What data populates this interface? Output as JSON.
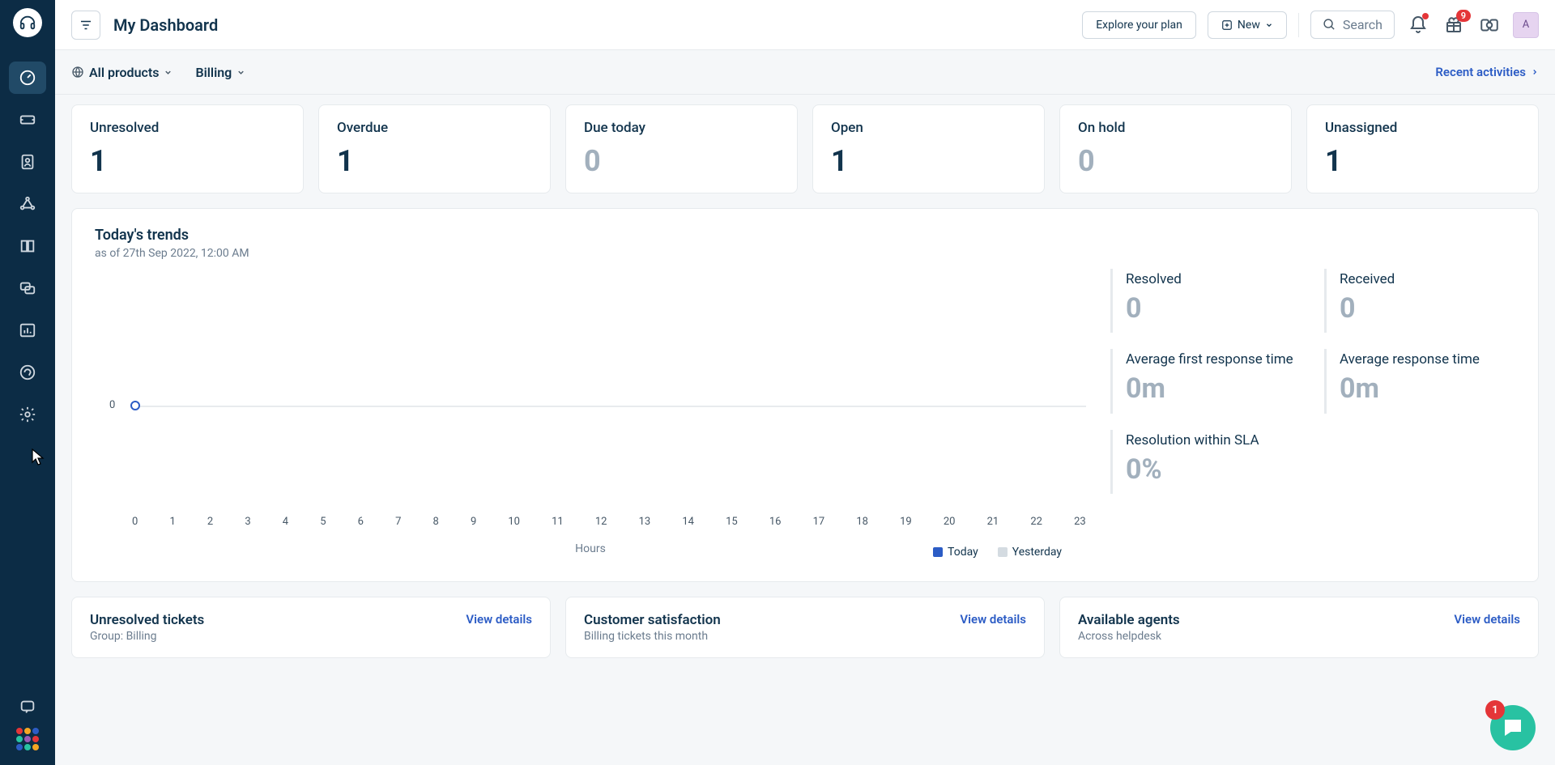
{
  "header": {
    "title": "My Dashboard",
    "explore": "Explore your plan",
    "new": "New",
    "search_placeholder": "Search",
    "gift_badge": "9",
    "avatar": "A"
  },
  "subheader": {
    "products": "All products",
    "group": "Billing",
    "recent": "Recent activities"
  },
  "stats": [
    {
      "label": "Unresolved",
      "value": "1",
      "zero": false
    },
    {
      "label": "Overdue",
      "value": "1",
      "zero": false
    },
    {
      "label": "Due today",
      "value": "0",
      "zero": true
    },
    {
      "label": "Open",
      "value": "1",
      "zero": false
    },
    {
      "label": "On hold",
      "value": "0",
      "zero": true
    },
    {
      "label": "Unassigned",
      "value": "1",
      "zero": false
    }
  ],
  "trends": {
    "title": "Today's trends",
    "subtitle": "as of 27th Sep 2022, 12:00 AM",
    "xlabel": "Hours",
    "legend_today": "Today",
    "legend_yesterday": "Yesterday",
    "y0": "0",
    "side": [
      {
        "label": "Resolved",
        "value": "0"
      },
      {
        "label": "Received",
        "value": "0"
      },
      {
        "label": "Average first response time",
        "value": "0m"
      },
      {
        "label": "Average response time",
        "value": "0m"
      },
      {
        "label": "Resolution within SLA",
        "value": "0%"
      }
    ]
  },
  "bottom": [
    {
      "title": "Unresolved tickets",
      "sub": "Group: Billing",
      "vd": "View details"
    },
    {
      "title": "Customer satisfaction",
      "sub": "Billing tickets this month",
      "vd": "View details"
    },
    {
      "title": "Available agents",
      "sub": "Across helpdesk",
      "vd": "View details"
    }
  ],
  "fab_badge": "1",
  "chart_data": {
    "type": "line",
    "x": [
      0,
      1,
      2,
      3,
      4,
      5,
      6,
      7,
      8,
      9,
      10,
      11,
      12,
      13,
      14,
      15,
      16,
      17,
      18,
      19,
      20,
      21,
      22,
      23
    ],
    "series": [
      {
        "name": "Today",
        "values": [
          0
        ]
      },
      {
        "name": "Yesterday",
        "values": []
      }
    ],
    "xlabel": "Hours",
    "ylabel": "",
    "ylim": [
      0,
      0
    ],
    "title": "Today's trends"
  },
  "xticks": [
    "0",
    "1",
    "2",
    "3",
    "4",
    "5",
    "6",
    "7",
    "8",
    "9",
    "10",
    "11",
    "12",
    "13",
    "14",
    "15",
    "16",
    "17",
    "18",
    "19",
    "20",
    "21",
    "22",
    "23"
  ]
}
